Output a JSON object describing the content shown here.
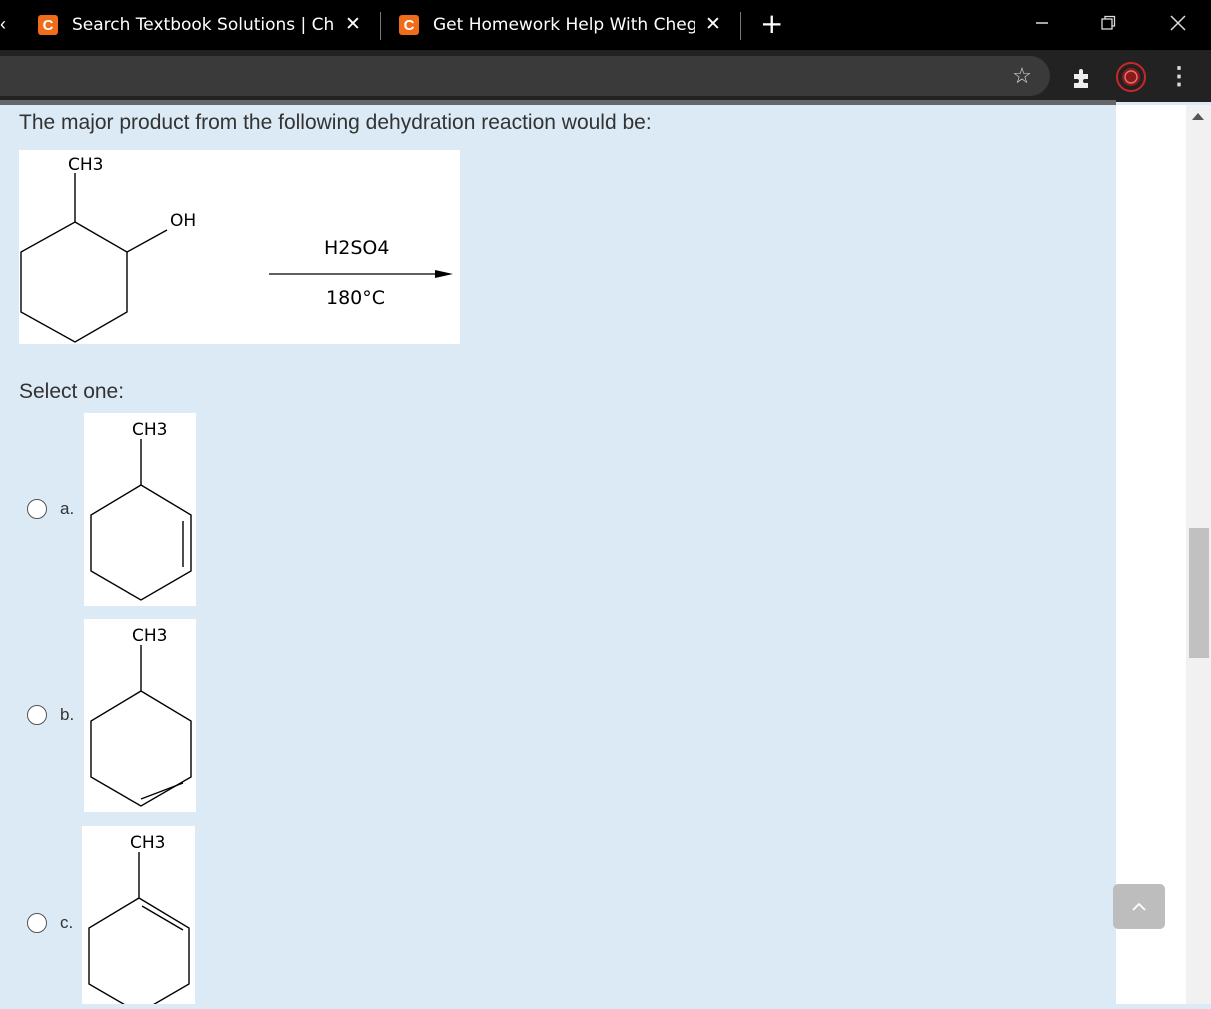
{
  "browser": {
    "tabs": [
      {
        "favicon": "C",
        "title": "Search Textbook Solutions | Cheg",
        "close": "✕"
      },
      {
        "favicon": "C",
        "title": "Get Homework Help With Chegg",
        "close": "✕"
      }
    ],
    "new_tab": "+",
    "window": {
      "minimize": "—",
      "restore": "❐",
      "close": "✕"
    },
    "toolbar": {
      "bookmark": "☆",
      "extensions": "puzzle-icon",
      "profile": "profile-avatar",
      "menu": "⋮"
    }
  },
  "question": {
    "prompt": "The major product from the following dehydration reaction would be:",
    "reaction": {
      "reactant_substituent": "CH3",
      "hydroxyl": "OH",
      "reagent": "H2SO4",
      "temperature": "180°C"
    },
    "select_label": "Select one:",
    "options": [
      {
        "letter": "a.",
        "structure_label": "CH3"
      },
      {
        "letter": "b.",
        "structure_label": "CH3"
      },
      {
        "letter": "c.",
        "structure_label": "CH3"
      }
    ]
  },
  "scroll_top_icon": "chevron-up-icon",
  "colors": {
    "page_bg": "#dbeaf4",
    "favicon": "#ef6c1b",
    "titlebar": "#000000",
    "toolbar": "#222222"
  }
}
